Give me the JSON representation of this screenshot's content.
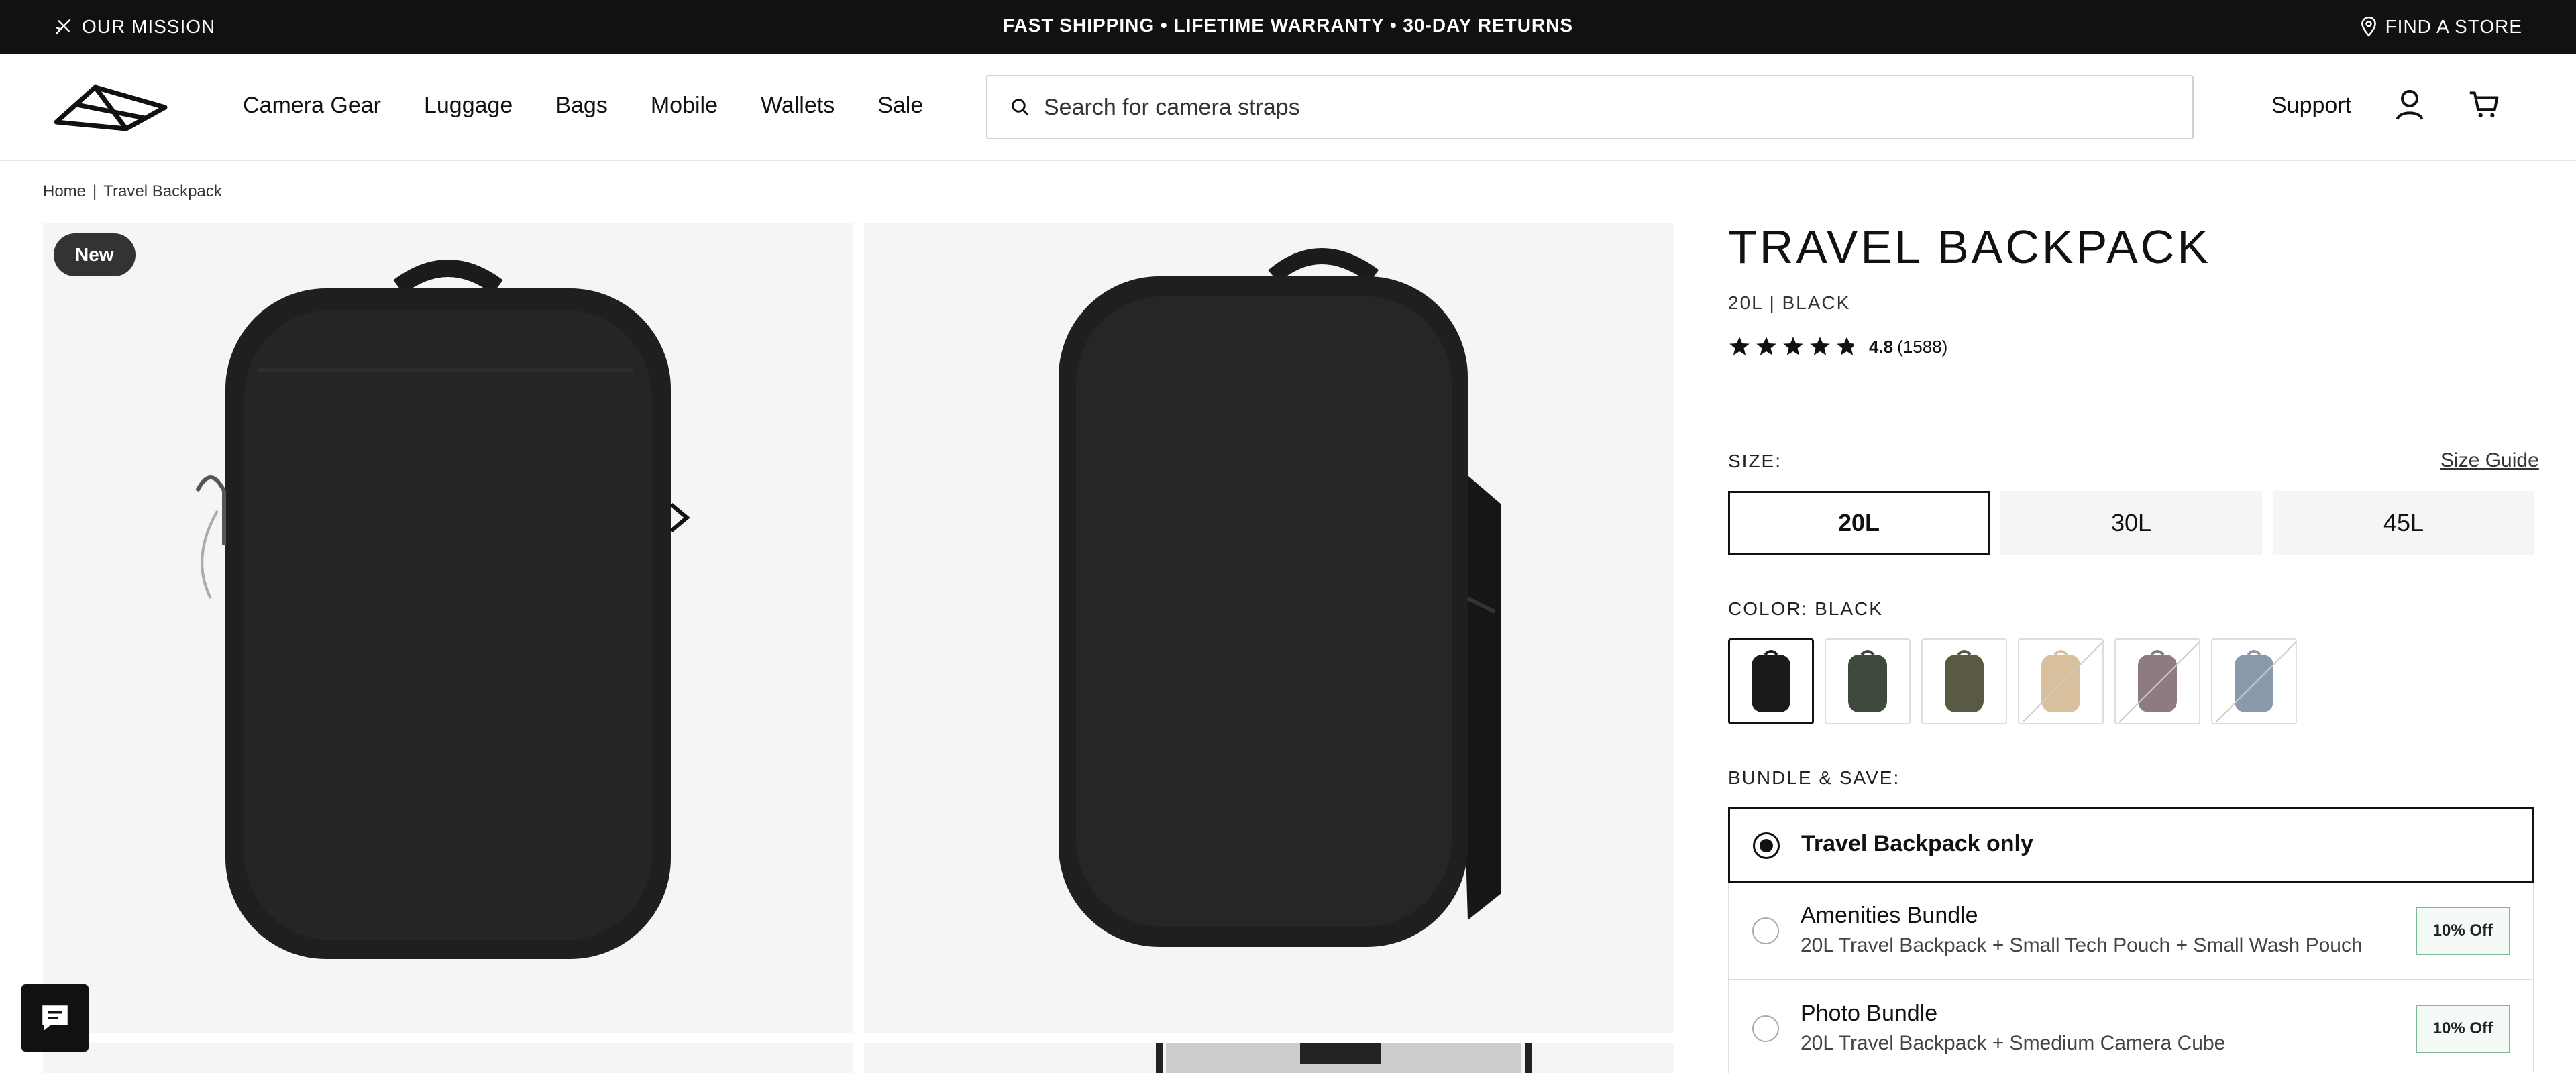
{
  "topbar": {
    "mission": "OUR MISSION",
    "promo": "FAST SHIPPING • LIFETIME WARRANTY • 30-DAY RETURNS",
    "store": "FIND A STORE"
  },
  "nav": {
    "links": [
      "Camera Gear",
      "Luggage",
      "Bags",
      "Mobile",
      "Wallets",
      "Sale"
    ],
    "search_placeholder": "Search for camera straps",
    "support": "Support"
  },
  "breadcrumb": {
    "home": "Home",
    "sep": "|",
    "current": "Travel Backpack"
  },
  "gallery": {
    "badge": "New"
  },
  "product": {
    "title": "TRAVEL BACKPACK",
    "variant": "20L | BLACK",
    "rating": "4.8",
    "reviews": "(1588)",
    "size_label": "SIZE:",
    "size_guide": "Size Guide",
    "sizes": [
      "20L",
      "30L",
      "45L"
    ],
    "color_label": "COLOR: BLACK",
    "colors": [
      {
        "name": "black",
        "hex": "#1a1a1a"
      },
      {
        "name": "sage",
        "hex": "#3f4a3c"
      },
      {
        "name": "olive",
        "hex": "#5a5a44"
      },
      {
        "name": "tan",
        "hex": "#d9c09c"
      },
      {
        "name": "mauve",
        "hex": "#8e7b80"
      },
      {
        "name": "blue",
        "hex": "#8a99ac"
      }
    ],
    "bundle_label": "BUNDLE & SAVE:",
    "bundles": [
      {
        "name": "Travel Backpack only",
        "desc": "",
        "badge": ""
      },
      {
        "name": "Amenities Bundle",
        "desc": "20L Travel Backpack + Small Tech Pouch + Small Wash Pouch",
        "badge": "10% Off"
      },
      {
        "name": "Photo Bundle",
        "desc": "20L Travel Backpack + Smedium Camera Cube",
        "badge": "10% Off"
      }
    ]
  },
  "colors": {
    "accent": "#111111",
    "offer_border": "#7fb894"
  }
}
